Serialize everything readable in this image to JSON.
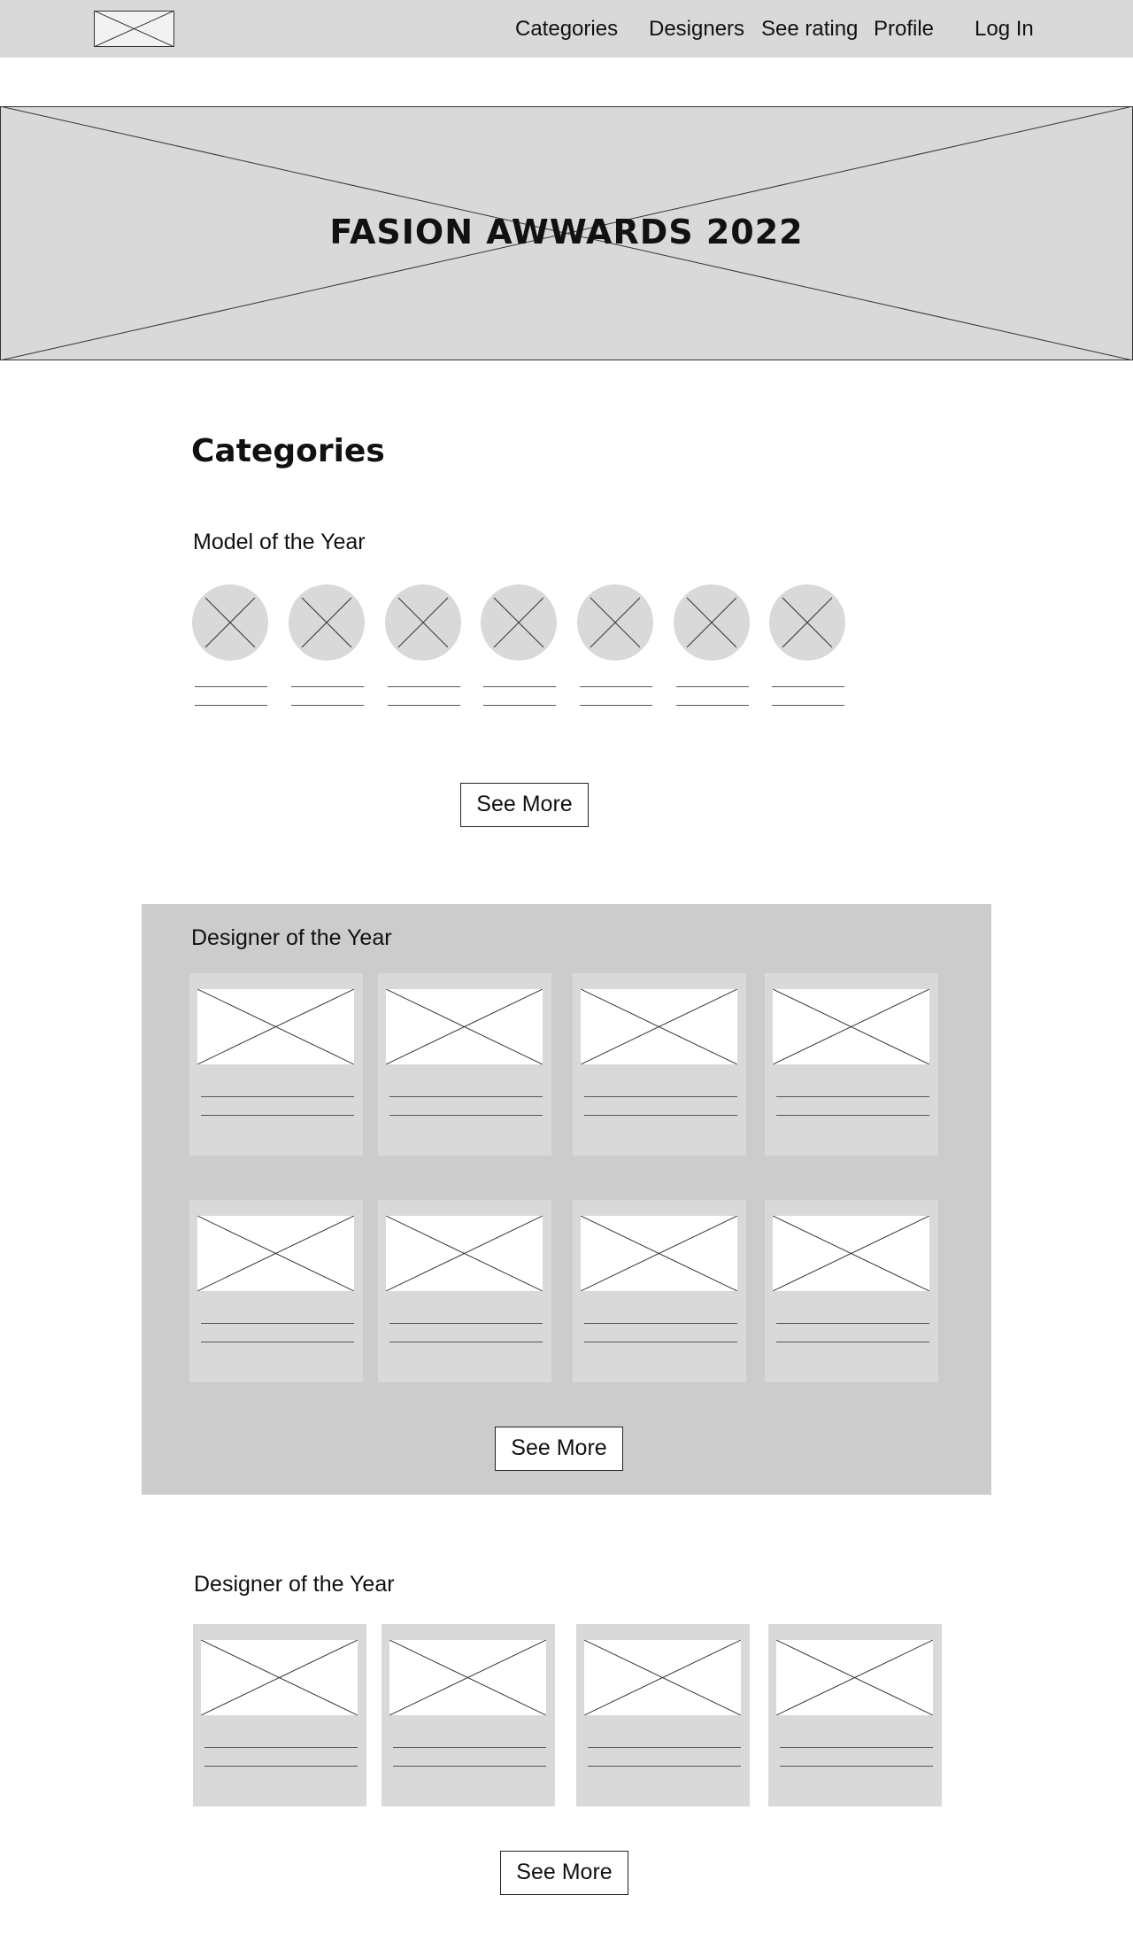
{
  "nav": {
    "logo_icon": "image-placeholder-icon",
    "links": [
      "Categories",
      "Designers",
      "See rating",
      "Profile"
    ],
    "login": "Log In"
  },
  "hero": {
    "title": "FASION AWWARDS 2022",
    "image_icon": "image-placeholder-icon"
  },
  "categories": {
    "heading": "Categories",
    "model_section": {
      "title": "Model of the Year",
      "avatar_icon": "avatar-placeholder-icon",
      "see_more": "See More"
    },
    "designer_panel": {
      "title": "Designer of the Year",
      "see_more": "See More"
    },
    "designer_section_2": {
      "title": "Designer of the Year",
      "see_more": "See More"
    }
  },
  "colors": {
    "placeholder_gray": "#d9d9d9",
    "panel_gray": "#cccccc"
  }
}
